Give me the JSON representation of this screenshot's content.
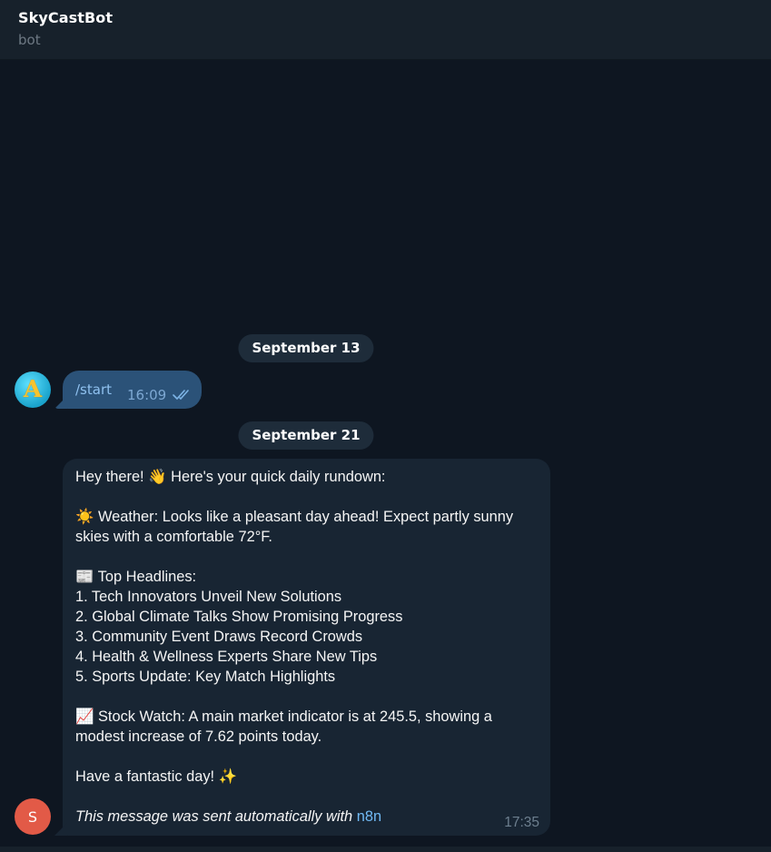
{
  "header": {
    "title": "SkyCastBot",
    "subtitle": "bot"
  },
  "chat": {
    "date1": "September 13",
    "date2": "September 21",
    "outgoing": {
      "text": "/start",
      "time": "16:09",
      "avatar_icon": "sparkle-a-avatar-icon"
    },
    "incoming": {
      "avatar_letter": "S",
      "time": "17:35",
      "greeting": "Hey there! 👋 Here's your quick daily rundown:",
      "weather_line1": "☀️ Weather: Looks like a pleasant day ahead! Expect partly sunny",
      "weather_line2": "skies with a comfortable 72°F.",
      "headlines_title": "📰 Top Headlines:",
      "headlines": [
        "1.  Tech Innovators Unveil New Solutions",
        "2.  Global Climate Talks Show Promising Progress",
        "3.  Community Event Draws Record Crowds",
        "4.  Health & Wellness Experts Share New Tips",
        "5.  Sports Update: Key Match Highlights"
      ],
      "stock_line1": "📈 Stock Watch: A main market indicator is at 245.5, showing a",
      "stock_line2": "modest increase of 7.62 points today.",
      "closing": "Have a fantastic day! ✨",
      "footer_prefix": "This message was sent automatically with ",
      "footer_link": "n8n"
    }
  },
  "colors": {
    "background": "#0e1621",
    "header": "#17212b",
    "outgoing_bubble": "#2b5278",
    "incoming_bubble": "#182533",
    "link": "#71baf5"
  }
}
